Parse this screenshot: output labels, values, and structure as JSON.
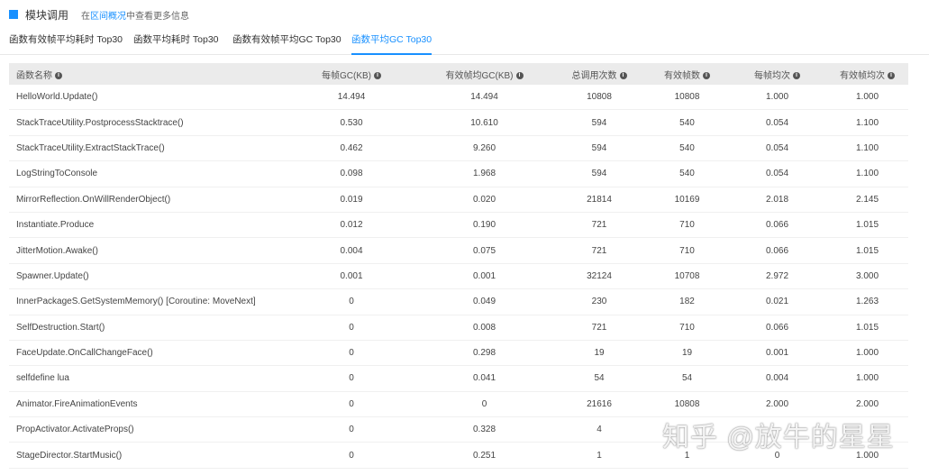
{
  "header": {
    "title": "模块调用",
    "hint_prefix": "在",
    "hint_link": "区间概况",
    "hint_suffix": "中查看更多信息"
  },
  "tabs": [
    {
      "label": "函数有效帧平均耗时 Top30",
      "active": false
    },
    {
      "label": "函数平均耗时 Top30",
      "active": false
    },
    {
      "label": "函数有效帧平均GC Top30",
      "active": false
    },
    {
      "label": "函数平均GC Top30",
      "active": true
    }
  ],
  "table": {
    "columns": [
      "函数名称",
      "每帧GC(KB)",
      "有效帧均GC(KB)",
      "总调用次数",
      "有效帧数",
      "每帧均次",
      "有效帧均次"
    ],
    "rows": [
      [
        "HelloWorld.Update()",
        "14.494",
        "14.494",
        "10808",
        "10808",
        "1.000",
        "1.000"
      ],
      [
        "StackTraceUtility.PostprocessStacktrace()",
        "0.530",
        "10.610",
        "594",
        "540",
        "0.054",
        "1.100"
      ],
      [
        "StackTraceUtility.ExtractStackTrace()",
        "0.462",
        "9.260",
        "594",
        "540",
        "0.054",
        "1.100"
      ],
      [
        "LogStringToConsole",
        "0.098",
        "1.968",
        "594",
        "540",
        "0.054",
        "1.100"
      ],
      [
        "MirrorReflection.OnWillRenderObject()",
        "0.019",
        "0.020",
        "21814",
        "10169",
        "2.018",
        "2.145"
      ],
      [
        "Instantiate.Produce",
        "0.012",
        "0.190",
        "721",
        "710",
        "0.066",
        "1.015"
      ],
      [
        "JitterMotion.Awake()",
        "0.004",
        "0.075",
        "721",
        "710",
        "0.066",
        "1.015"
      ],
      [
        "Spawner.Update()",
        "0.001",
        "0.001",
        "32124",
        "10708",
        "2.972",
        "3.000"
      ],
      [
        "InnerPackageS.GetSystemMemory() [Coroutine: MoveNext]",
        "0",
        "0.049",
        "230",
        "182",
        "0.021",
        "1.263"
      ],
      [
        "SelfDestruction.Start()",
        "0",
        "0.008",
        "721",
        "710",
        "0.066",
        "1.015"
      ],
      [
        "FaceUpdate.OnCallChangeFace()",
        "0",
        "0.298",
        "19",
        "19",
        "0.001",
        "1.000"
      ],
      [
        "selfdefine lua",
        "0",
        "0.041",
        "54",
        "54",
        "0.004",
        "1.000"
      ],
      [
        "Animator.FireAnimationEvents",
        "0",
        "0",
        "21616",
        "10808",
        "2.000",
        "2.000"
      ],
      [
        "PropActivator.ActivateProps()",
        "0",
        "0.328",
        "4",
        "",
        "",
        ""
      ],
      [
        "StageDirector.StartMusic()",
        "0",
        "0.251",
        "1",
        "1",
        "0",
        "1.000"
      ]
    ]
  },
  "watermark": "知乎 @放牛的星星",
  "colors": {
    "accent": "#1890ff",
    "header_bg": "#ebebeb"
  }
}
